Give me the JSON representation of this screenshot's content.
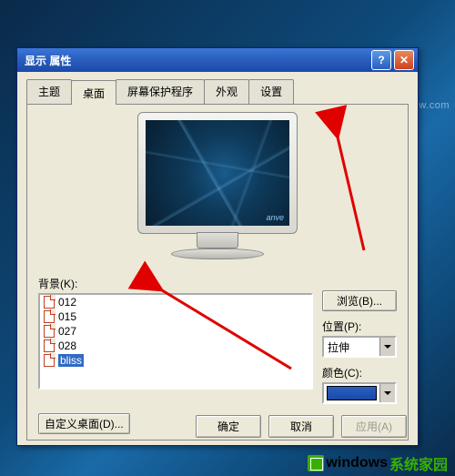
{
  "window": {
    "title": "显示 属性",
    "help_glyph": "?",
    "close_glyph": "✕"
  },
  "tabs": {
    "theme": "主题",
    "desktop": "桌面",
    "screensaver": "屏幕保护程序",
    "appearance": "外观",
    "settings": "设置"
  },
  "preview": {
    "brand": "anve"
  },
  "background": {
    "label": "背景(K):",
    "items": [
      {
        "name": "012",
        "selected": false
      },
      {
        "name": "015",
        "selected": false
      },
      {
        "name": "027",
        "selected": false
      },
      {
        "name": "028",
        "selected": false
      },
      {
        "name": "bliss",
        "selected": true
      }
    ]
  },
  "browse": {
    "label": "浏览(B)..."
  },
  "position": {
    "label": "位置(P):",
    "value": "拉伸"
  },
  "color": {
    "label": "颜色(C):",
    "value_hex": "#1a4aa8"
  },
  "customize": {
    "label": "自定义桌面(D)..."
  },
  "buttons": {
    "ok": "确定",
    "cancel": "取消",
    "apply": "应用(A)"
  },
  "watermark": {
    "t1": "windows",
    "t2": "系统家园",
    "url": "www.ruihaiw.com"
  }
}
